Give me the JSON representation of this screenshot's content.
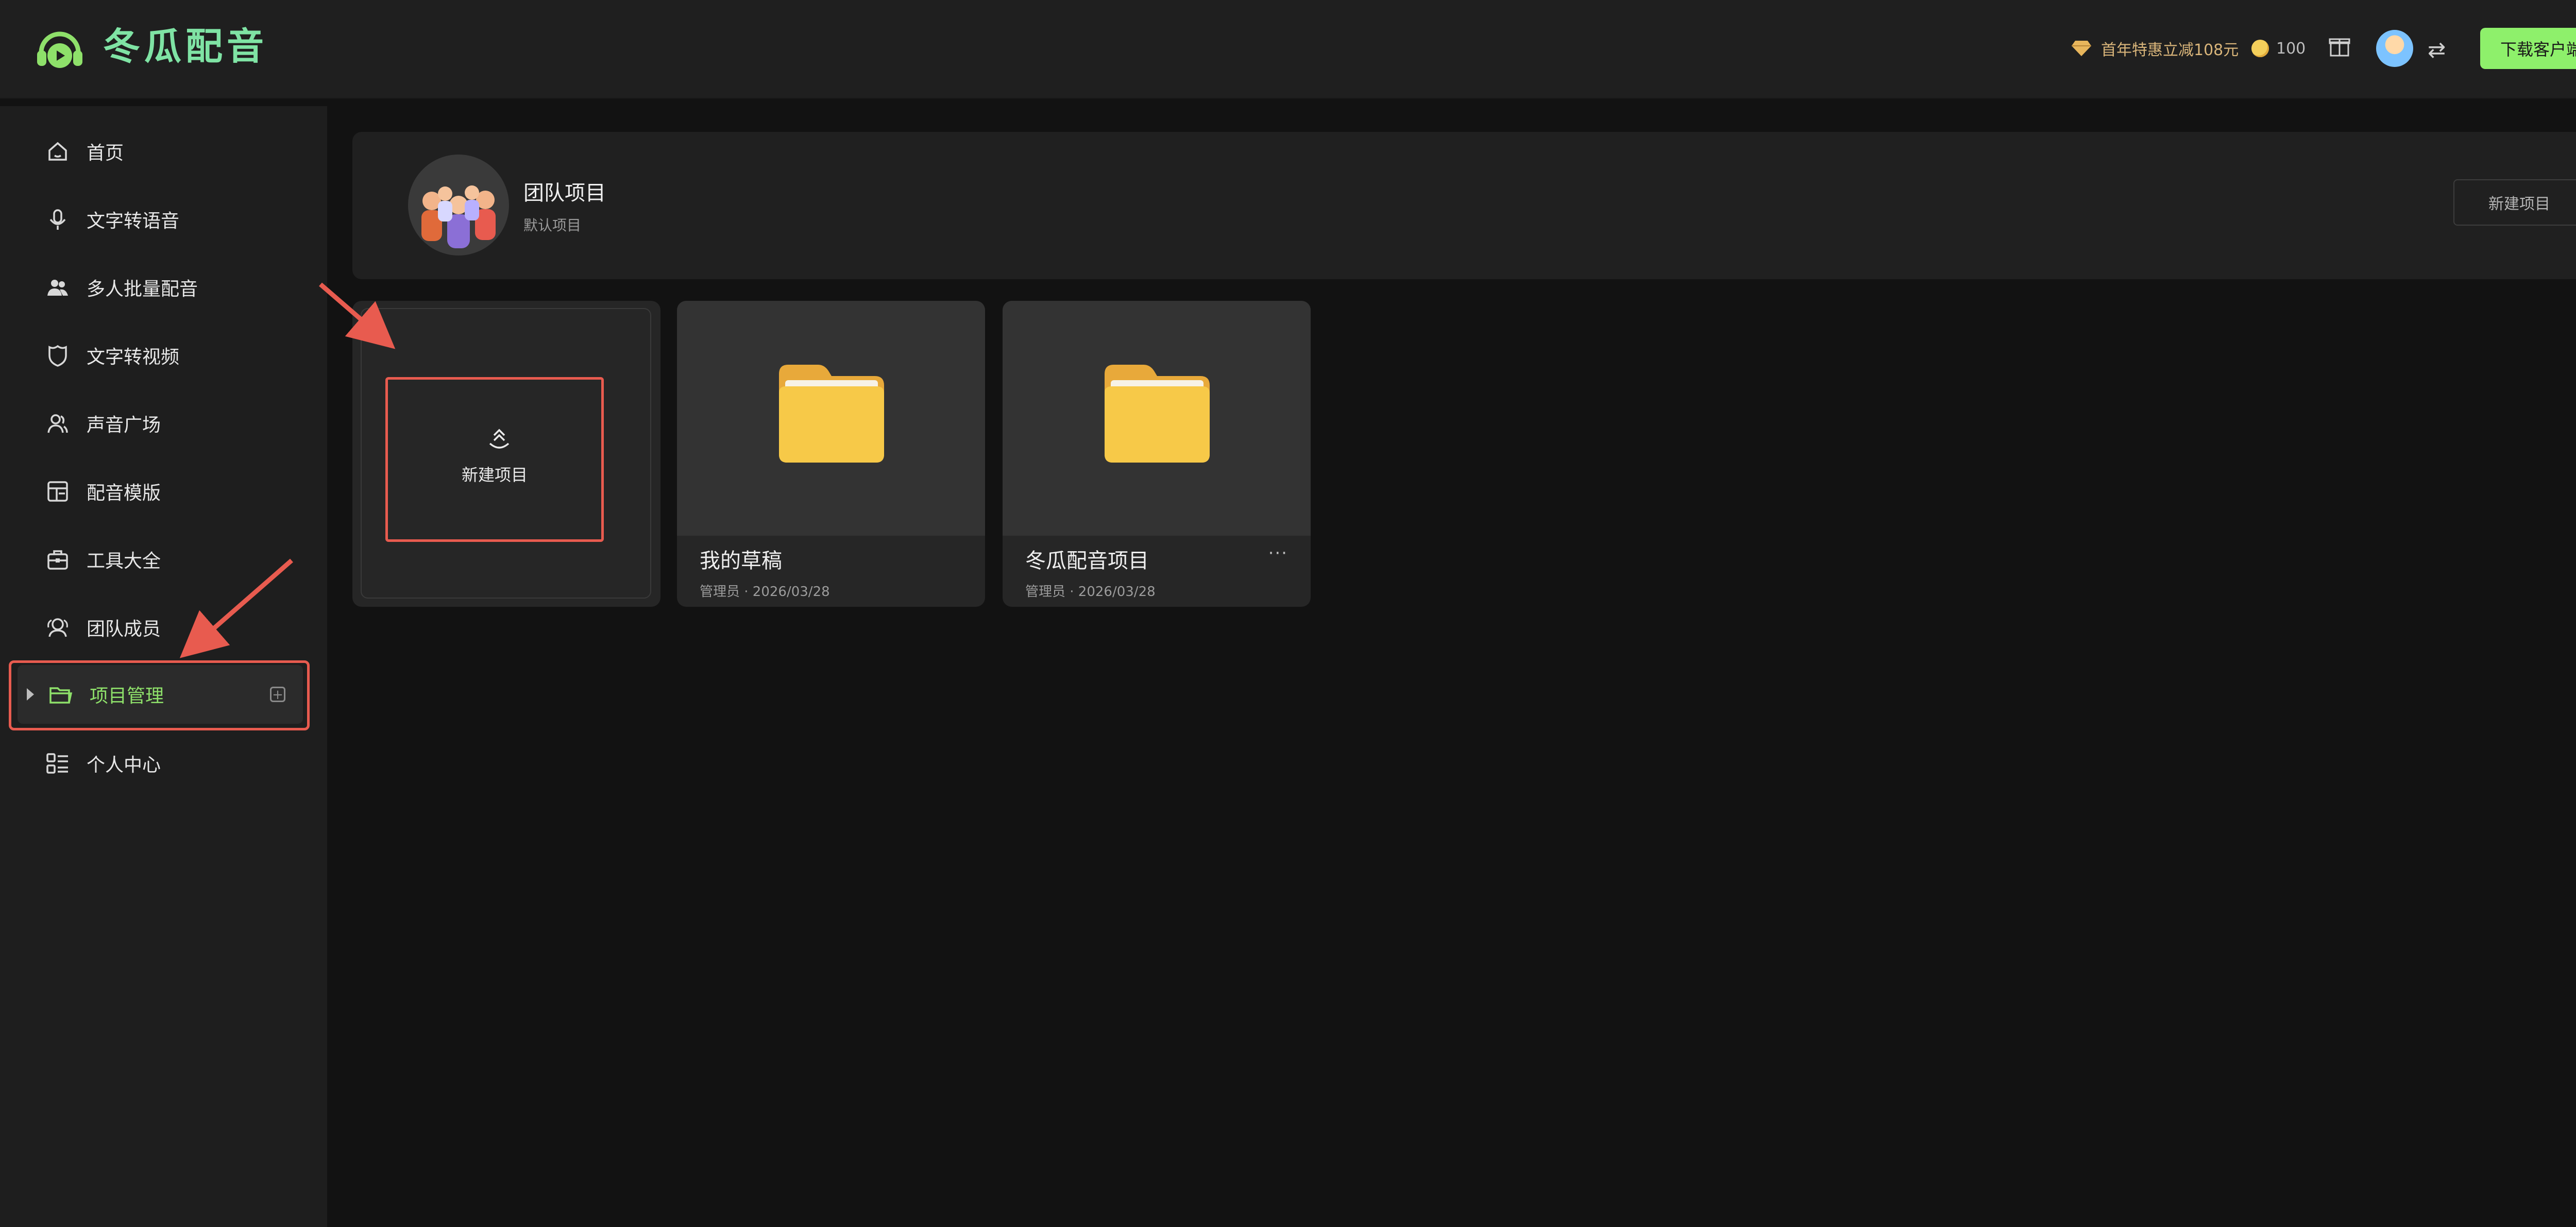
{
  "app": {
    "brand": "冬瓜配音"
  },
  "topbar": {
    "promo_text": "首年特惠立减108元",
    "coins": "100",
    "download_label": "下载客户端",
    "switch_glyph": "⇄"
  },
  "sidebar": {
    "items": [
      {
        "label": "首页",
        "icon": "home-icon"
      },
      {
        "label": "文字转语音",
        "icon": "microphone-icon"
      },
      {
        "label": "多人批量配音",
        "icon": "users-icon"
      },
      {
        "label": "文字转视频",
        "icon": "shield-icon"
      },
      {
        "label": "声音广场",
        "icon": "people-icon"
      },
      {
        "label": "配音模版",
        "icon": "template-icon"
      },
      {
        "label": "工具大全",
        "icon": "toolbox-icon"
      },
      {
        "label": "团队成员",
        "icon": "team-icon"
      },
      {
        "label": "项目管理",
        "icon": "folder-open-icon",
        "active": true
      },
      {
        "label": "个人中心",
        "icon": "profile-list-icon"
      }
    ],
    "add_glyph": "+"
  },
  "project_header": {
    "title": "团队项目",
    "subtitle": "默认项目",
    "new_button": "新建项目"
  },
  "cards": [
    {
      "type": "new",
      "label": "新建项目"
    },
    {
      "type": "folder",
      "name": "我的草稿",
      "meta": "管理员 · 2026/03/28"
    },
    {
      "type": "folder",
      "name": "冬瓜配音项目",
      "meta": "管理员 · 2026/03/28",
      "more": "···"
    }
  ],
  "colors": {
    "accent_green": "#8ef06b",
    "brand_text": "#7fe3a4",
    "annotation_red": "#e85b4f",
    "folder_yellow": "#f7c948"
  }
}
